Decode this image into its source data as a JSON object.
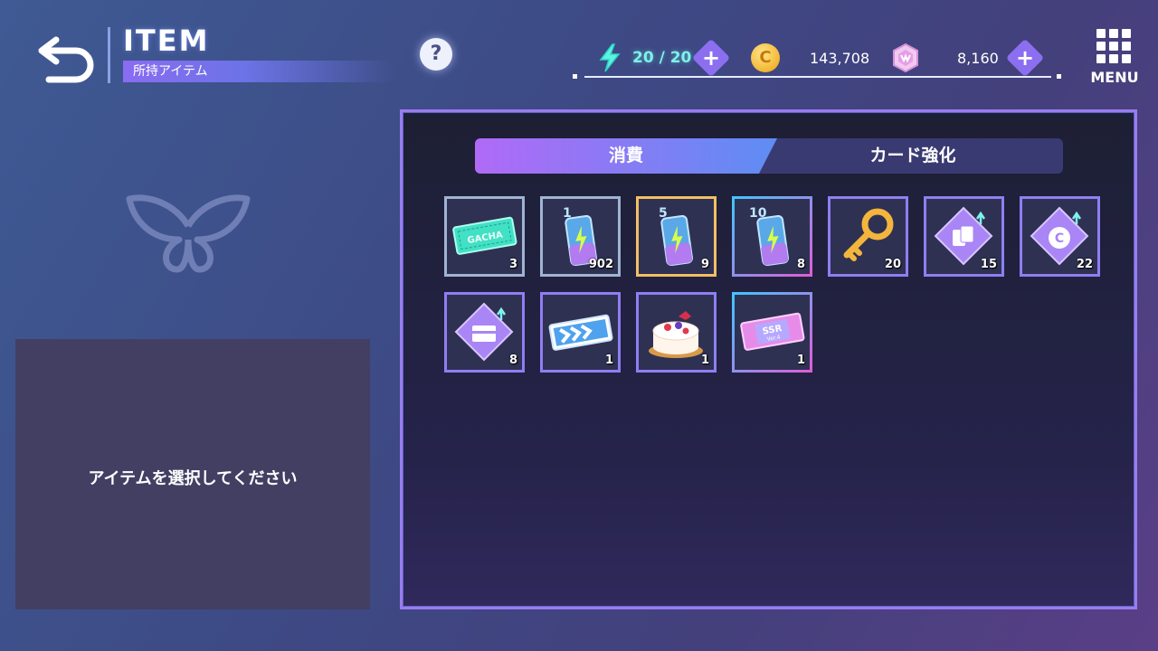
{
  "header": {
    "title": "ITEM",
    "subtitle": "所持アイテム",
    "help_label": "?"
  },
  "resources": {
    "energy": "20 / 20",
    "coins": "143,708",
    "gems": "8,160",
    "plus_label": "+",
    "coin_symbol": "C"
  },
  "menu": {
    "label": "MENU"
  },
  "detail": {
    "placeholder": "アイテムを選択してください"
  },
  "tabs": [
    {
      "label": "消費",
      "active": true
    },
    {
      "label": "カード強化",
      "active": false
    }
  ],
  "items": [
    {
      "name": "gacha-ticket",
      "count": "3",
      "ticket_text": "GACHA"
    },
    {
      "name": "energy-drink-1",
      "count": "902",
      "badge": "1"
    },
    {
      "name": "energy-drink-5",
      "count": "9",
      "badge": "5"
    },
    {
      "name": "energy-drink-10",
      "count": "8",
      "badge": "10"
    },
    {
      "name": "gold-key",
      "count": "20"
    },
    {
      "name": "card-upgrade-item",
      "count": "15"
    },
    {
      "name": "coin-upgrade-item",
      "count": "22",
      "symbol": "C"
    },
    {
      "name": "chest-upgrade-item",
      "count": "8"
    },
    {
      "name": "skip-ticket",
      "count": "1"
    },
    {
      "name": "cake",
      "count": "1"
    },
    {
      "name": "ssr-ticket",
      "count": "1",
      "ticket_text": "SSR",
      "ticket_sub": "Ver.4"
    }
  ],
  "colors": {
    "accent_purple": "#8b6ff0",
    "energy_cyan": "#7ff0e6",
    "coin_gold": "#f2b632",
    "panel_border": "#9a7cf0"
  }
}
